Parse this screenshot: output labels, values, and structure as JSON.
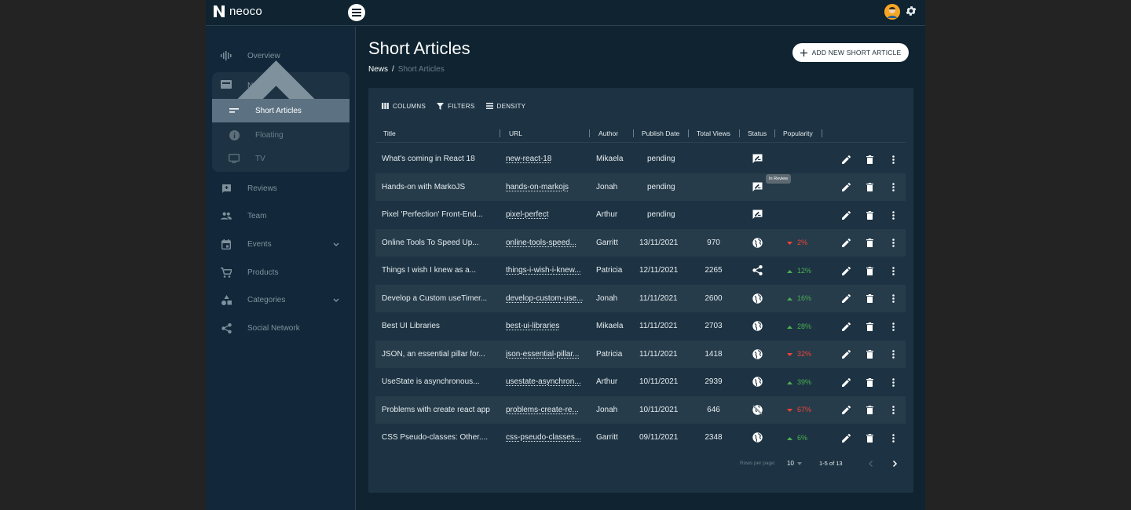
{
  "app": {
    "name": "neoco"
  },
  "sidebar": {
    "items": [
      {
        "label": "Overview",
        "icon": "pulse-icon"
      },
      {
        "label": "News",
        "icon": "news-icon"
      },
      {
        "label": "Reviews",
        "icon": "review-icon"
      },
      {
        "label": "Team",
        "icon": "people-icon"
      },
      {
        "label": "Events",
        "icon": "calendar-icon"
      },
      {
        "label": "Products",
        "icon": "cart-icon"
      },
      {
        "label": "Categories",
        "icon": "shapes-icon"
      },
      {
        "label": "Social Network",
        "icon": "share-icon"
      }
    ],
    "news_sub": [
      {
        "label": "Short Articles",
        "icon": "short-text-icon",
        "active": true
      },
      {
        "label": "Floating",
        "icon": "info-icon"
      },
      {
        "label": "TV",
        "icon": "tv-icon"
      }
    ]
  },
  "page": {
    "title": "Short Articles",
    "breadcrumb": {
      "parent": "News",
      "separator": "/",
      "current": "Short Articles"
    },
    "add_button": "ADD NEW SHORT ARTICLE"
  },
  "toolbar": {
    "columns": "COLUMNS",
    "filters": "FILTERS",
    "density": "DENSITY"
  },
  "table": {
    "headers": {
      "title": "Title",
      "url": "URL",
      "author": "Author",
      "date": "Publish Date",
      "views": "Total Views",
      "status": "Status",
      "popularity": "Popularity"
    },
    "rows": [
      {
        "title": "What's coming in React 18",
        "url": "new-react-18",
        "author": "Mikaela",
        "date": "pending",
        "views": "",
        "status": "review-icon",
        "trend": "",
        "pop": ""
      },
      {
        "title": "Hands-on with MarkoJS",
        "url": "hands-on-markojs",
        "author": "Jonah",
        "date": "pending",
        "views": "",
        "status": "review-icon",
        "trend": "",
        "pop": ""
      },
      {
        "title": "Pixel 'Perfection' Front-End...",
        "url": "pixel-perfect",
        "author": "Arthur",
        "date": "pending",
        "views": "",
        "status": "review-icon",
        "trend": "",
        "pop": ""
      },
      {
        "title": "Online Tools To Speed Up...",
        "url": "online-tools-speed...",
        "author": "Garritt",
        "date": "13/11/2021",
        "views": "970",
        "status": "globe-icon",
        "trend": "down",
        "pop": "2%"
      },
      {
        "title": "Things I wish I knew as a...",
        "url": "things-i-wish-i-knew...",
        "author": "Patricia",
        "date": "12/11/2021",
        "views": "2265",
        "status": "share-icon",
        "trend": "up",
        "pop": "12%"
      },
      {
        "title": "Develop a Custom useTimer...",
        "url": "develop-custom-use...",
        "author": "Jonah",
        "date": "11/11/2021",
        "views": "2600",
        "status": "globe-icon",
        "trend": "up",
        "pop": "16%"
      },
      {
        "title": "Best UI Libraries",
        "url": "best-ui-libraries",
        "author": "Mikaela",
        "date": "11/11/2021",
        "views": "2703",
        "status": "globe-icon",
        "trend": "up",
        "pop": "28%"
      },
      {
        "title": "JSON, an essential pillar for...",
        "url": "json-essential-pillar...",
        "author": "Patricia",
        "date": "11/11/2021",
        "views": "1418",
        "status": "globe-icon",
        "trend": "down",
        "pop": "32%"
      },
      {
        "title": "UseState is asynchronous...",
        "url": "usestate-asynchron...",
        "author": "Arthur",
        "date": "10/11/2021",
        "views": "2939",
        "status": "globe-icon",
        "trend": "up",
        "pop": "39%"
      },
      {
        "title": "Problems with create react app",
        "url": "problems-create-re...",
        "author": "Jonah",
        "date": "10/11/2021",
        "views": "646",
        "status": "globe-off-icon",
        "trend": "down",
        "pop": "67%"
      },
      {
        "title": "CSS Pseudo-classes: Other....",
        "url": "css-pseudo-classes...",
        "author": "Garritt",
        "date": "09/11/2021",
        "views": "2348",
        "status": "globe-icon",
        "trend": "up",
        "pop": "6%"
      }
    ],
    "tooltip": "In Review"
  },
  "pagination": {
    "rows_per_page_label": "Rows per page:",
    "rows_per_page": "10",
    "range": "1-5 of 13"
  },
  "colors": {
    "up": "#4caf50",
    "down": "#f44336",
    "bg": "#0f2330",
    "card": "#1d3343"
  }
}
